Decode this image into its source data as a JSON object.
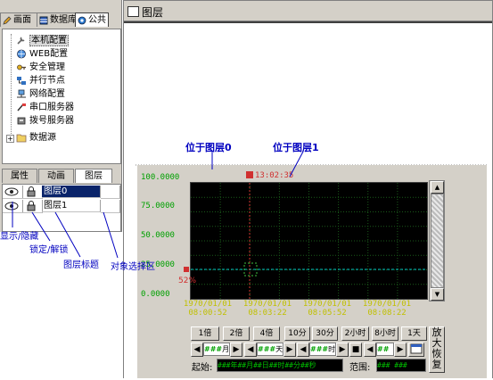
{
  "left_panel": {
    "top_tabs": [
      "画面",
      "数据库",
      "公共"
    ],
    "tree_items": [
      {
        "label": "本机配置",
        "icon": "wrench-icon"
      },
      {
        "label": "WEB配置",
        "icon": "web-icon"
      },
      {
        "label": "安全管理",
        "icon": "key-icon"
      },
      {
        "label": "并行节点",
        "icon": "network-node-icon"
      },
      {
        "label": "网络配置",
        "icon": "network-icon"
      },
      {
        "label": "串口服务器",
        "icon": "serial-icon"
      },
      {
        "label": "拨号服务器",
        "icon": "phone-icon"
      },
      {
        "label": "数据源",
        "icon": "folder-icon"
      }
    ],
    "bottom_tabs": [
      "属性",
      "动画",
      "图层"
    ],
    "layers": [
      {
        "name": "图层0"
      },
      {
        "name": "图层1"
      }
    ]
  },
  "main": {
    "title": "图层"
  },
  "trend": {
    "time_label": "13:02:35",
    "y_labels": [
      "100.0000",
      "75.0000",
      "50.0000",
      "25.0000",
      "0.0000"
    ],
    "x_labels": [
      {
        "date": "1970/01/01",
        "time": "08:00:52"
      },
      {
        "date": "1970/01/01",
        "time": "08:03:22"
      },
      {
        "date": "1970/01/01",
        "time": "08:05:52"
      },
      {
        "date": "1970/01/01",
        "time": "08:08:22"
      }
    ],
    "cursor_value": "52%",
    "zoom_buttons": [
      "1倍",
      "2倍",
      "4倍",
      "10分",
      "30分",
      "2小时",
      "8小时",
      "1天"
    ],
    "spin_month_label": "月",
    "spin_day_label": "天",
    "spin_hour_label": "时",
    "start_label": "起始:",
    "start_value": "###年##月##日##时##分##秒",
    "range_label": "范围:",
    "range_value": "### ###",
    "side_buttons": [
      "放大",
      "恢复"
    ]
  },
  "annotations": {
    "layer0": "位于图层0",
    "layer1": "位于图层1",
    "show_hide": "显示/隐藏",
    "lock_unlock": "锁定/解锁",
    "layer_title": "图层标题",
    "object_select": "对象选择区"
  },
  "colors": {
    "panel": "#d4d0c8",
    "plot_bg": "#000000",
    "grid": "#1a5a1a",
    "annotation": "#0000c0",
    "cursor_line": "#00c0c0",
    "x_label": "#c0c000"
  }
}
